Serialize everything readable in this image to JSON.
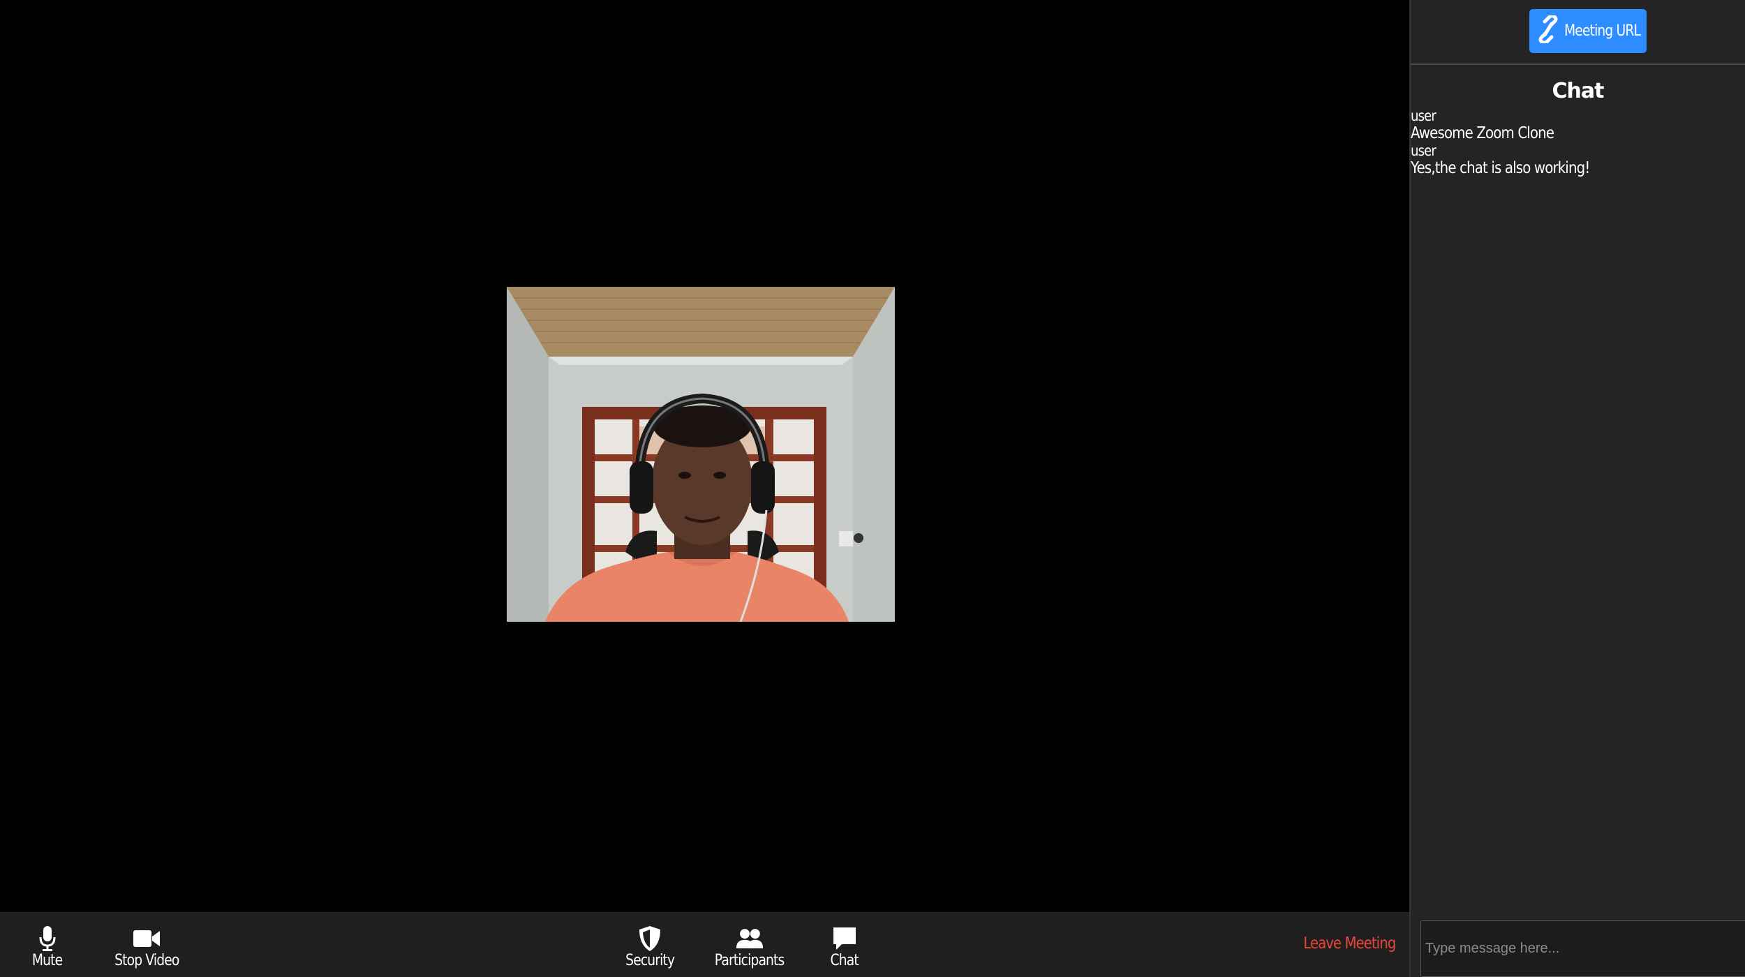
{
  "toolbar": {
    "mute_label": "Mute",
    "stop_video_label": "Stop Video",
    "security_label": "Security",
    "participants_label": "Participants",
    "chat_label": "Chat",
    "leave_label": "Leave Meeting"
  },
  "panel": {
    "meeting_url_label": "Meeting URL",
    "chat_title": "Chat",
    "messages": [
      {
        "user": "user",
        "text": "Awesome Zoom Clone"
      },
      {
        "user": "user",
        "text": "Yes,the chat is also working!"
      }
    ],
    "input_placeholder": "Type message here..."
  },
  "colors": {
    "accent": "#2d8cff",
    "leave": "#e8483b",
    "panel_bg": "#242424",
    "toolbar_bg": "#1f1f1f"
  },
  "icons": [
    "microphone-icon",
    "video-camera-icon",
    "shield-icon",
    "participants-icon",
    "chat-bubble-icon",
    "link-icon"
  ]
}
